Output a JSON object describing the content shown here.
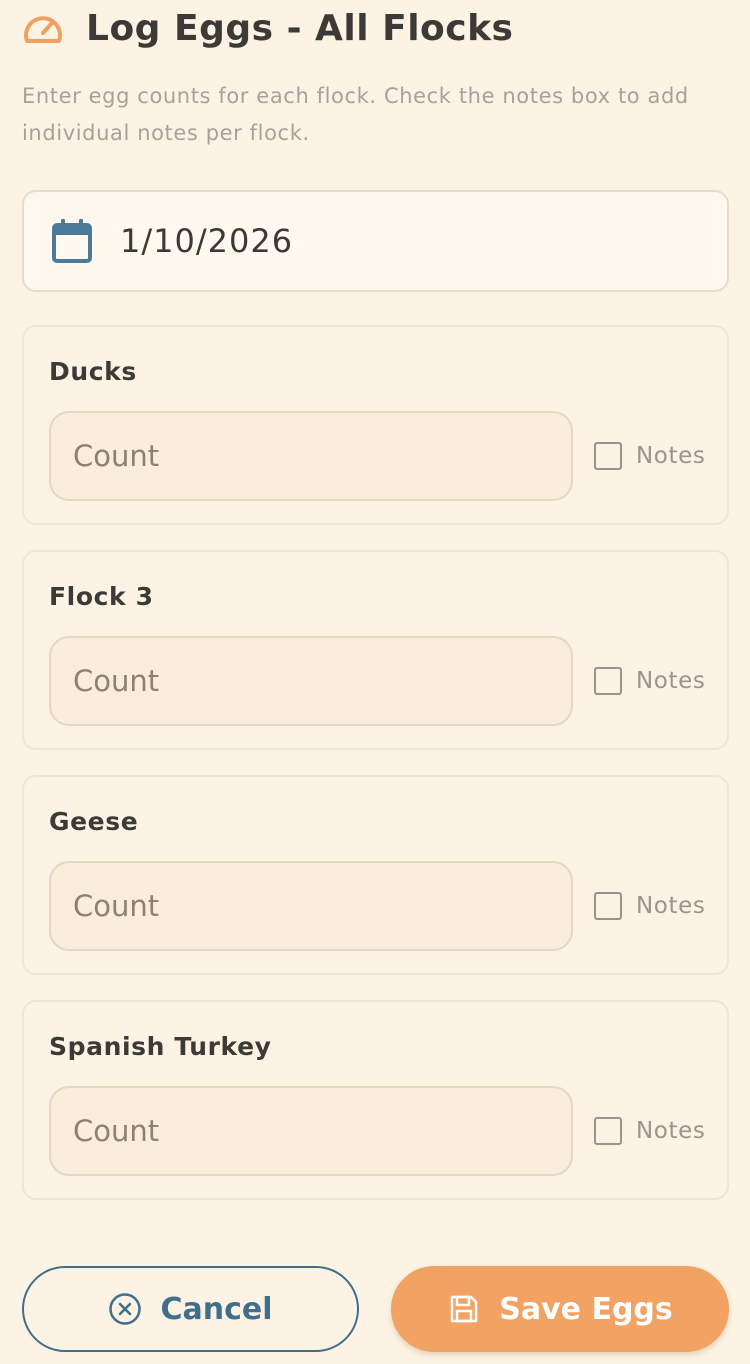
{
  "header": {
    "title": "Log Eggs - All Flocks",
    "icon": "gauge-icon",
    "icon_color": "#f0a05f"
  },
  "subtitle": "Enter egg counts for each flock. Check the notes box to add individual notes per flock.",
  "date_field": {
    "value": "1/10/2026",
    "icon": "calendar-icon",
    "icon_color": "#4d7a99"
  },
  "flocks": [
    {
      "name": "Ducks",
      "count_placeholder": "Count",
      "count_value": "",
      "notes_label": "Notes",
      "notes_checked": false
    },
    {
      "name": "Flock 3",
      "count_placeholder": "Count",
      "count_value": "",
      "notes_label": "Notes",
      "notes_checked": false
    },
    {
      "name": "Geese",
      "count_placeholder": "Count",
      "count_value": "",
      "notes_label": "Notes",
      "notes_checked": false
    },
    {
      "name": "Spanish Turkey",
      "count_placeholder": "Count",
      "count_value": "",
      "notes_label": "Notes",
      "notes_checked": false
    }
  ],
  "actions": {
    "cancel_label": "Cancel",
    "cancel_icon": "circle-x-icon",
    "save_label": "Save Eggs",
    "save_icon": "floppy-disk-icon"
  },
  "colors": {
    "background": "#fdf3e4",
    "accent": "#f2a263",
    "secondary": "#3f6f8a"
  }
}
